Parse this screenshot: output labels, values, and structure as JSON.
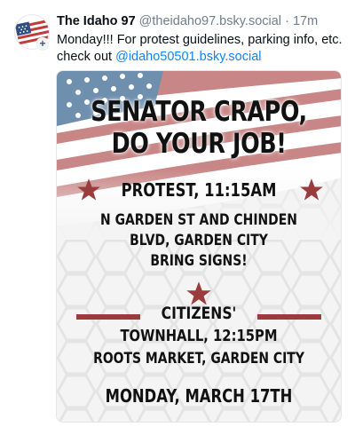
{
  "post": {
    "display_name": "The Idaho 97",
    "handle": "@theidaho97.bsky.social",
    "separator": "·",
    "timestamp": "17m",
    "text_before_mention": "Monday!!! For protest guidelines, parking info, etc. check out ",
    "mention": "@idaho50501.bsky.social",
    "avatar_icon": "us-flag-avatar-icon",
    "follow_badge": "+"
  },
  "flyer": {
    "headline_line1": "SENATOR CRAPO,",
    "headline_line2": "DO YOUR JOB!",
    "protest": "PROTEST, 11:15AM",
    "address_line1": "N GARDEN ST AND CHINDEN",
    "address_line2": "BLVD, GARDEN CITY",
    "bring_signs": "BRING SIGNS!",
    "citizens": "CITIZENS'",
    "townhall": "TOWNHALL, 12:15PM",
    "location": "ROOTS MARKET, GARDEN CITY",
    "date": "MONDAY, MARCH 17TH",
    "colors": {
      "star_red": "#9b3c3c",
      "flag_blue": "#5f7f9c",
      "stripe_red": "#b86a6a"
    }
  },
  "colors": {
    "link_blue": "#1083fe",
    "text_primary": "#0b0f14",
    "text_secondary": "#6f7d8c"
  }
}
